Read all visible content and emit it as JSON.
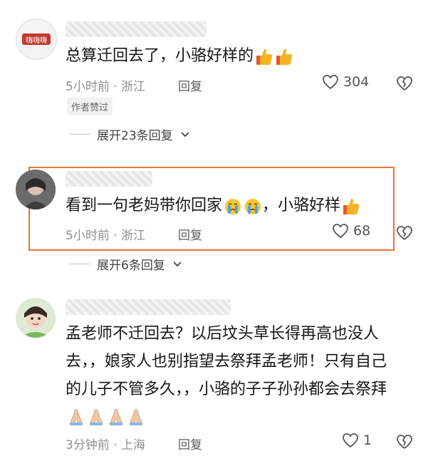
{
  "comments": [
    {
      "text": "总算迁回去了，小骆好样的",
      "time_location": "5小时前 · 浙江",
      "reply": "回复",
      "likes": "304",
      "badge": "作者赞过",
      "expand": "展开23条回复",
      "avatar_text": "嗨嗨嗨",
      "emojis": [
        "thumbs-up-icon",
        "thumbs-up-icon"
      ]
    },
    {
      "text": "看到一句老妈带你回家",
      "text_tail": "，小骆好样",
      "time_location": "5小时前 · 浙江",
      "reply": "回复",
      "likes": "68",
      "expand": "展开6条回复",
      "emojis": [
        "crying-face-icon",
        "crying-face-icon",
        "thumbs-up-icon"
      ]
    },
    {
      "lines": [
        "孟老师不迁回去？以后坟头草长得再高也没人",
        "去，，娘家人也别指望去祭拜孟老师！只有自己",
        "的儿子不管多久，，小骆的子子孙孙都会去祭拜"
      ],
      "time_location": "3分钟前 · 上海",
      "reply": "回复",
      "likes": "1",
      "emojis": [
        "praying-hands-icon",
        "praying-hands-icon",
        "praying-hands-icon",
        "praying-hands-icon"
      ]
    }
  ],
  "colors": {
    "highlight": "#e8743b",
    "meta": "#8f8f8f"
  }
}
